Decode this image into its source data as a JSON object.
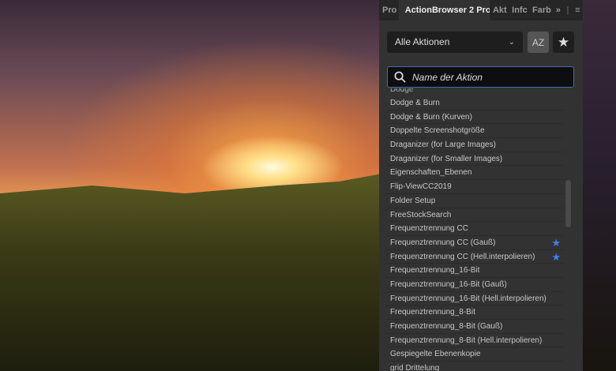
{
  "tabs": [
    "Pro",
    "ActionBrowser 2 Pro",
    "Akt",
    "Infc",
    "Farb"
  ],
  "tab_more": "»",
  "tab_menu": "≡",
  "filter": {
    "selected": "Alle Aktionen"
  },
  "sort_button": "AZ",
  "favorites_button": "★",
  "search": {
    "placeholder": "Name der Aktion"
  },
  "list_partial_top": "Dodge",
  "items": [
    {
      "label": "Dodge & Burn",
      "fav": false
    },
    {
      "label": "Dodge & Burn (Kurven)",
      "fav": false
    },
    {
      "label": "Doppelte Screenshotgröße",
      "fav": false
    },
    {
      "label": "Draganizer (for Large Images)",
      "fav": false
    },
    {
      "label": "Draganizer (for Smaller Images)",
      "fav": false
    },
    {
      "label": "Eigenschaften_Ebenen",
      "fav": false
    },
    {
      "label": "Flip-ViewCC2019",
      "fav": false
    },
    {
      "label": "Folder Setup",
      "fav": false
    },
    {
      "label": "FreeStockSearch",
      "fav": false
    },
    {
      "label": "Frequenztrennung CC",
      "fav": false
    },
    {
      "label": "Frequenztrennung CC (Gauß)",
      "fav": true
    },
    {
      "label": "Frequenztrennung CC (Hell.interpolieren)",
      "fav": true
    },
    {
      "label": "Frequenztrennung_16-Bit",
      "fav": false
    },
    {
      "label": "Frequenztrennung_16-Bit (Gauß)",
      "fav": false
    },
    {
      "label": "Frequenztrennung_16-Bit (Hell.interpolieren)",
      "fav": false
    },
    {
      "label": "Frequenztrennung_8-Bit",
      "fav": false
    },
    {
      "label": "Frequenztrennung_8-Bit (Gauß)",
      "fav": false
    },
    {
      "label": "Frequenztrennung_8-Bit (Hell.interpolieren)",
      "fav": false
    },
    {
      "label": "Gespiegelte Ebenenkopie",
      "fav": false
    },
    {
      "label": "grid Drittelung",
      "fav": false
    }
  ],
  "colors": {
    "accent": "#3b82f6",
    "panel": "#323232"
  }
}
